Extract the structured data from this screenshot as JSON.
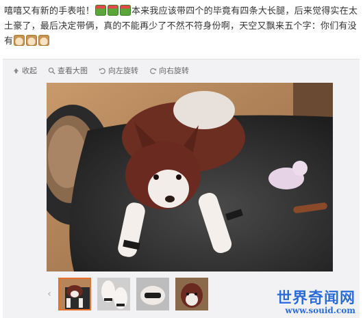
{
  "post": {
    "text_1": "嘻嘻又有新的手表啦！",
    "text_2": "本来我应该带四个的毕竟有四条大长腿，后来觉得实在太土豪了，最后决定带俩，真的不能再少了不然不符身份啊，天空又飘来五个字：你们有没有",
    "emoji_gift": "gift-emoji",
    "emoji_doge": "doge-emoji"
  },
  "toolbar": {
    "collapse_label": "收起",
    "view_large_label": "查看大图",
    "rotate_left_label": "向左旋转",
    "rotate_right_label": "向右旋转"
  },
  "gallery": {
    "thumbnail_count": 4,
    "active_index": 0,
    "prev_arrow": "‹"
  },
  "watermark": {
    "title": "世界奇闻网",
    "url": "www.souid.com"
  },
  "colors": {
    "accent_active": "#e8702a",
    "watermark_blue": "#2b6cd8",
    "media_bg": "#f2f2f5"
  }
}
